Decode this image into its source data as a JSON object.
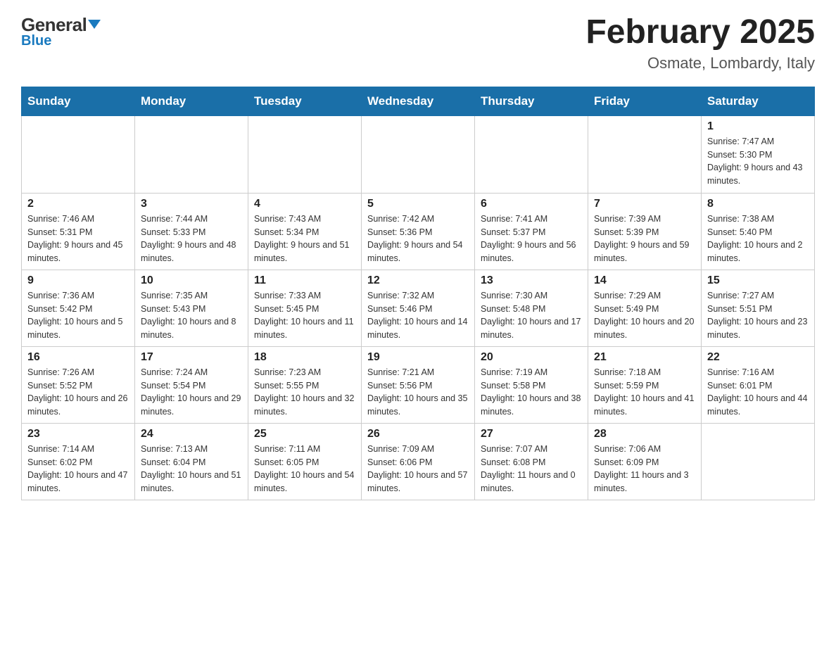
{
  "logo": {
    "general": "General",
    "blue": "Blue",
    "triangle": "▼"
  },
  "title": "February 2025",
  "subtitle": "Osmate, Lombardy, Italy",
  "weekdays": [
    "Sunday",
    "Monday",
    "Tuesday",
    "Wednesday",
    "Thursday",
    "Friday",
    "Saturday"
  ],
  "weeks": [
    [
      {
        "day": "",
        "info": ""
      },
      {
        "day": "",
        "info": ""
      },
      {
        "day": "",
        "info": ""
      },
      {
        "day": "",
        "info": ""
      },
      {
        "day": "",
        "info": ""
      },
      {
        "day": "",
        "info": ""
      },
      {
        "day": "1",
        "info": "Sunrise: 7:47 AM\nSunset: 5:30 PM\nDaylight: 9 hours and 43 minutes."
      }
    ],
    [
      {
        "day": "2",
        "info": "Sunrise: 7:46 AM\nSunset: 5:31 PM\nDaylight: 9 hours and 45 minutes."
      },
      {
        "day": "3",
        "info": "Sunrise: 7:44 AM\nSunset: 5:33 PM\nDaylight: 9 hours and 48 minutes."
      },
      {
        "day": "4",
        "info": "Sunrise: 7:43 AM\nSunset: 5:34 PM\nDaylight: 9 hours and 51 minutes."
      },
      {
        "day": "5",
        "info": "Sunrise: 7:42 AM\nSunset: 5:36 PM\nDaylight: 9 hours and 54 minutes."
      },
      {
        "day": "6",
        "info": "Sunrise: 7:41 AM\nSunset: 5:37 PM\nDaylight: 9 hours and 56 minutes."
      },
      {
        "day": "7",
        "info": "Sunrise: 7:39 AM\nSunset: 5:39 PM\nDaylight: 9 hours and 59 minutes."
      },
      {
        "day": "8",
        "info": "Sunrise: 7:38 AM\nSunset: 5:40 PM\nDaylight: 10 hours and 2 minutes."
      }
    ],
    [
      {
        "day": "9",
        "info": "Sunrise: 7:36 AM\nSunset: 5:42 PM\nDaylight: 10 hours and 5 minutes."
      },
      {
        "day": "10",
        "info": "Sunrise: 7:35 AM\nSunset: 5:43 PM\nDaylight: 10 hours and 8 minutes."
      },
      {
        "day": "11",
        "info": "Sunrise: 7:33 AM\nSunset: 5:45 PM\nDaylight: 10 hours and 11 minutes."
      },
      {
        "day": "12",
        "info": "Sunrise: 7:32 AM\nSunset: 5:46 PM\nDaylight: 10 hours and 14 minutes."
      },
      {
        "day": "13",
        "info": "Sunrise: 7:30 AM\nSunset: 5:48 PM\nDaylight: 10 hours and 17 minutes."
      },
      {
        "day": "14",
        "info": "Sunrise: 7:29 AM\nSunset: 5:49 PM\nDaylight: 10 hours and 20 minutes."
      },
      {
        "day": "15",
        "info": "Sunrise: 7:27 AM\nSunset: 5:51 PM\nDaylight: 10 hours and 23 minutes."
      }
    ],
    [
      {
        "day": "16",
        "info": "Sunrise: 7:26 AM\nSunset: 5:52 PM\nDaylight: 10 hours and 26 minutes."
      },
      {
        "day": "17",
        "info": "Sunrise: 7:24 AM\nSunset: 5:54 PM\nDaylight: 10 hours and 29 minutes."
      },
      {
        "day": "18",
        "info": "Sunrise: 7:23 AM\nSunset: 5:55 PM\nDaylight: 10 hours and 32 minutes."
      },
      {
        "day": "19",
        "info": "Sunrise: 7:21 AM\nSunset: 5:56 PM\nDaylight: 10 hours and 35 minutes."
      },
      {
        "day": "20",
        "info": "Sunrise: 7:19 AM\nSunset: 5:58 PM\nDaylight: 10 hours and 38 minutes."
      },
      {
        "day": "21",
        "info": "Sunrise: 7:18 AM\nSunset: 5:59 PM\nDaylight: 10 hours and 41 minutes."
      },
      {
        "day": "22",
        "info": "Sunrise: 7:16 AM\nSunset: 6:01 PM\nDaylight: 10 hours and 44 minutes."
      }
    ],
    [
      {
        "day": "23",
        "info": "Sunrise: 7:14 AM\nSunset: 6:02 PM\nDaylight: 10 hours and 47 minutes."
      },
      {
        "day": "24",
        "info": "Sunrise: 7:13 AM\nSunset: 6:04 PM\nDaylight: 10 hours and 51 minutes."
      },
      {
        "day": "25",
        "info": "Sunrise: 7:11 AM\nSunset: 6:05 PM\nDaylight: 10 hours and 54 minutes."
      },
      {
        "day": "26",
        "info": "Sunrise: 7:09 AM\nSunset: 6:06 PM\nDaylight: 10 hours and 57 minutes."
      },
      {
        "day": "27",
        "info": "Sunrise: 7:07 AM\nSunset: 6:08 PM\nDaylight: 11 hours and 0 minutes."
      },
      {
        "day": "28",
        "info": "Sunrise: 7:06 AM\nSunset: 6:09 PM\nDaylight: 11 hours and 3 minutes."
      },
      {
        "day": "",
        "info": ""
      }
    ]
  ]
}
